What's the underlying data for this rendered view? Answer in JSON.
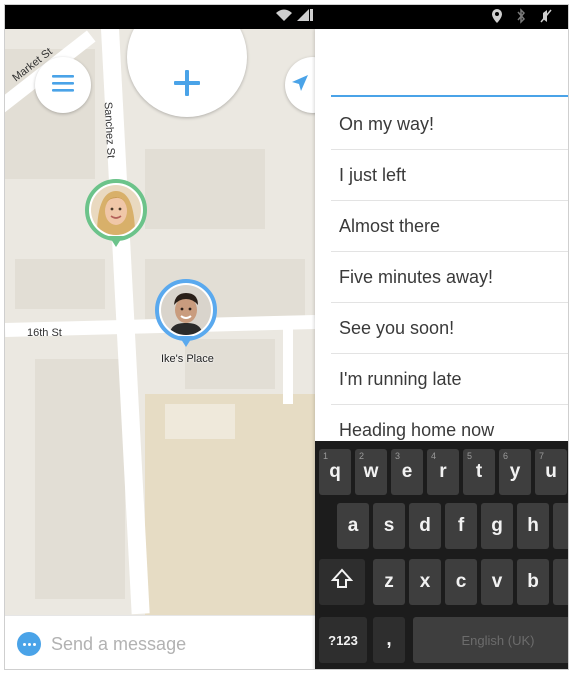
{
  "status_bar": {
    "wifi_icon": "wifi-icon",
    "signal_icon": "signal-icon",
    "location_icon": "location-icon",
    "bluetooth_icon": "bluetooth-icon",
    "mute_icon": "mute-icon"
  },
  "map": {
    "streets": {
      "market": "Market St",
      "sanchez": "Sanchez St",
      "sixteenth": "16th St"
    },
    "place_label": "Ike's Place",
    "buttons": {
      "menu_icon": "menu-icon",
      "add_icon": "plus-icon",
      "locate_icon": "navigation-arrow-icon"
    },
    "pins": [
      {
        "name": "friend-female",
        "ring_color": "#6cc38a"
      },
      {
        "name": "friend-male",
        "ring_color": "#5aa9ee"
      }
    ],
    "colors": {
      "accent": "#4aa3e8",
      "road": "#ffffff",
      "land": "#ebe8e1",
      "park": "#e6dcc4"
    }
  },
  "message_bar": {
    "placeholder": "Send a message",
    "icon": "chat-bubble-icon"
  },
  "quick_replies": {
    "items": [
      "On my way!",
      "I just left",
      "Almost there",
      "Five minutes away!",
      "See you soon!",
      "I'm running late",
      "Heading home now"
    ]
  },
  "keyboard": {
    "row1": [
      {
        "label": "q",
        "hint": "1"
      },
      {
        "label": "w",
        "hint": "2"
      },
      {
        "label": "e",
        "hint": "3"
      },
      {
        "label": "r",
        "hint": "4"
      },
      {
        "label": "t",
        "hint": "5"
      },
      {
        "label": "y",
        "hint": "6"
      },
      {
        "label": "u",
        "hint": "7"
      }
    ],
    "row2": [
      "a",
      "s",
      "d",
      "f",
      "g",
      "h"
    ],
    "row3": [
      "z",
      "x",
      "c",
      "v",
      "b"
    ],
    "shift_icon": "shift-arrow-icon",
    "symbols_label": "?123",
    "comma_label": ",",
    "space_label": "English (UK)"
  }
}
